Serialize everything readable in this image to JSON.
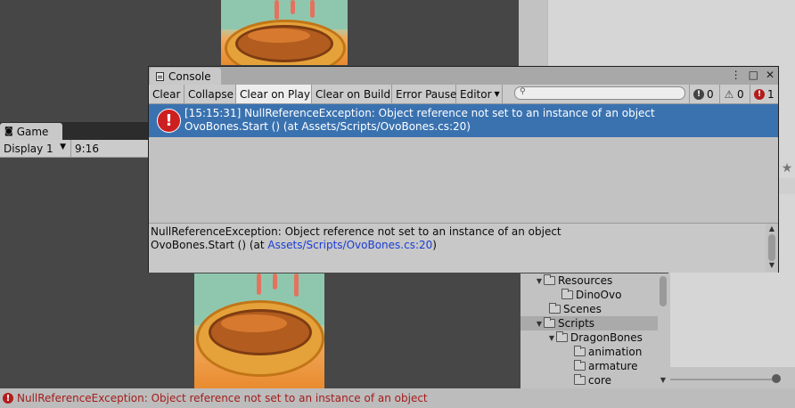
{
  "game_view": {
    "tab_label": "Game",
    "display_label": "Display 1",
    "aspect_label": "9:16"
  },
  "console": {
    "tab_label": "Console",
    "toolbar": {
      "clear": "Clear",
      "collapse": "Collapse",
      "clear_on_play": "Clear on Play",
      "clear_on_build": "Clear on Build",
      "error_pause": "Error Pause",
      "editor": "Editor"
    },
    "search": {
      "placeholder": ""
    },
    "counts": {
      "info": "0",
      "warnings": "0",
      "errors": "1"
    },
    "log": {
      "line1": "[15:15:31] NullReferenceException: Object reference not set to an instance of an object",
      "line2": "OvoBones.Start () (at Assets/Scripts/OvoBones.cs:20)"
    },
    "detail": {
      "line1": "NullReferenceException: Object reference not set to an instance of an object",
      "line2_prefix": "OvoBones.Start () (at ",
      "line2_link": "Assets/Scripts/OvoBones.cs:20",
      "line2_suffix": ")"
    }
  },
  "project_tree": {
    "items": [
      {
        "label": "Resources",
        "expanded": true
      },
      {
        "label": "DinoOvo"
      },
      {
        "label": "Scenes"
      },
      {
        "label": "Scripts",
        "expanded": true,
        "selected": true
      },
      {
        "label": "DragonBones",
        "expanded": true
      },
      {
        "label": "animation"
      },
      {
        "label": "armature"
      },
      {
        "label": "core"
      }
    ]
  },
  "status_bar": {
    "message": "NullReferenceException: Object reference not set to an instance of an object"
  },
  "colors": {
    "selection_blue": "#3a72b0",
    "error_red": "#b21c1c",
    "link_blue": "#1a3cd6"
  },
  "icons": [
    "console-tab-icon",
    "game-tab-icon",
    "search-icon",
    "info-icon",
    "warning-icon",
    "error-icon",
    "folder-icon",
    "star-icon"
  ]
}
